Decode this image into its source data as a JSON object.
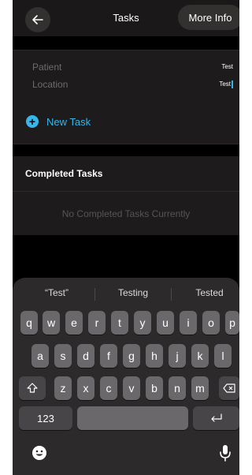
{
  "header": {
    "title": "Tasks",
    "more_info_label": "More Info"
  },
  "info": {
    "patient_label": "Patient",
    "patient_value": "Test",
    "location_label": "Location",
    "location_value": "Test"
  },
  "new_task_label": "New Task",
  "completed": {
    "title": "Completed Tasks",
    "empty_text": "No Completed Tasks Currently"
  },
  "keyboard": {
    "suggestions": [
      "“Test”",
      "Testing",
      "Tested"
    ],
    "row1": [
      "q",
      "w",
      "e",
      "r",
      "t",
      "y",
      "u",
      "i",
      "o",
      "p"
    ],
    "row2": [
      "a",
      "s",
      "d",
      "f",
      "g",
      "h",
      "j",
      "k",
      "l"
    ],
    "row3": [
      "z",
      "x",
      "c",
      "v",
      "b",
      "n",
      "m"
    ],
    "numbers_label": "123"
  },
  "colors": {
    "accent": "#37b6ea",
    "background": "#000000",
    "panel": "#1d1b1b"
  }
}
